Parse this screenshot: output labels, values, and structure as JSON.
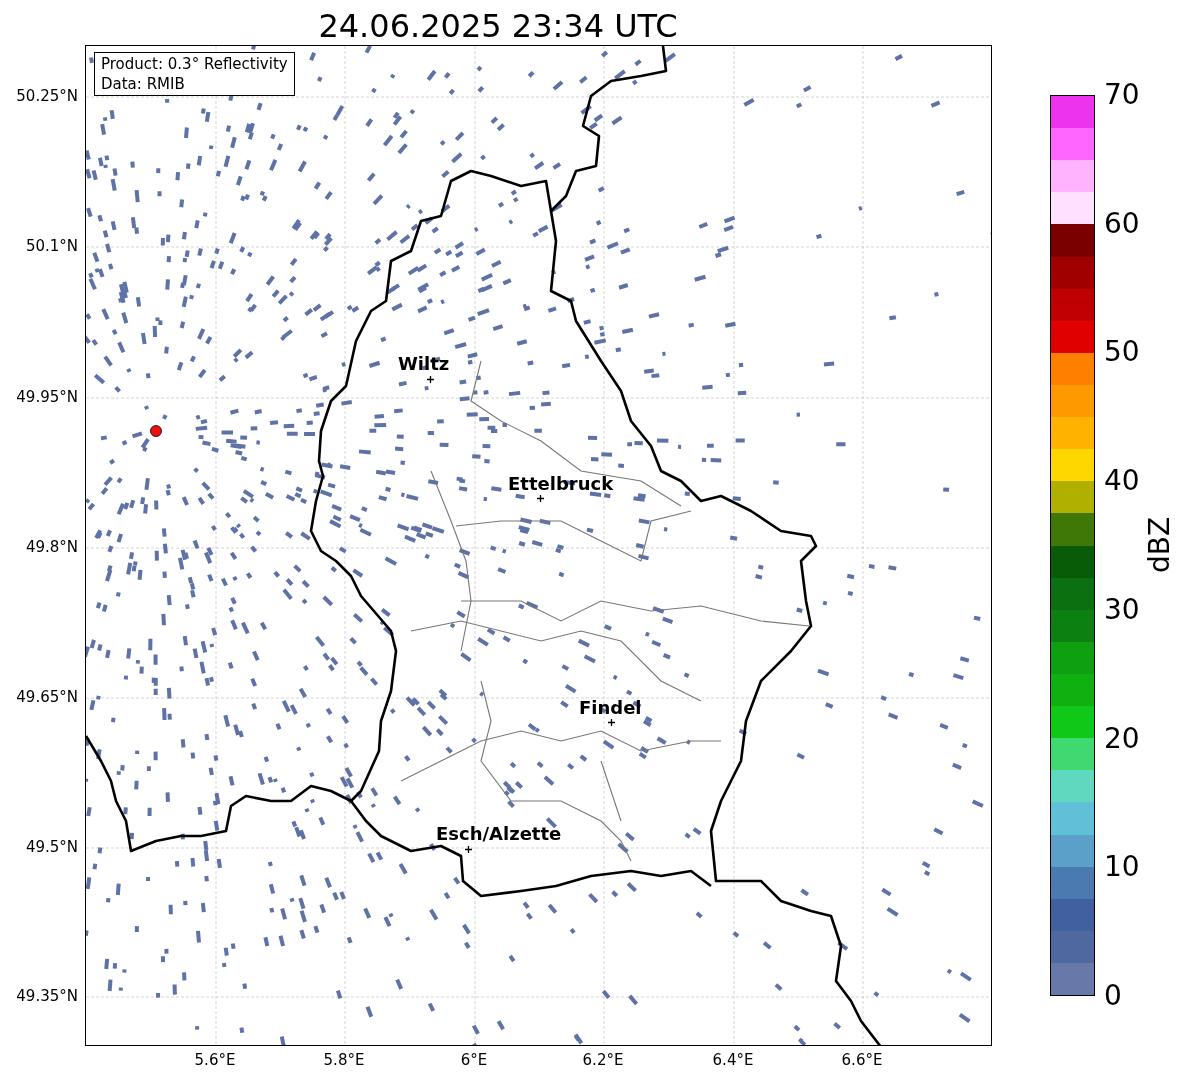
{
  "title": "24.06.2025 23:34 UTC",
  "map": {
    "info_box": [
      "Product: 0.3° Reflectivity",
      "Data: RMIB"
    ],
    "cities": [
      {
        "name": "Wiltz"
      },
      {
        "name": "Ettelbruck"
      },
      {
        "name": "Findel"
      },
      {
        "name": "Esch/Alzette"
      }
    ],
    "lat_ticks": [
      "50.25°N",
      "50.1°N",
      "49.95°N",
      "49.8°N",
      "49.65°N",
      "49.5°N",
      "49.35°N"
    ],
    "lon_ticks": [
      "5.6°E",
      "5.8°E",
      "6°E",
      "6.2°E",
      "6.4°E",
      "6.6°E"
    ]
  },
  "colorbar": {
    "label": "dBZ",
    "ticks": [
      "70",
      "60",
      "50",
      "40",
      "30",
      "20",
      "10",
      "0"
    ],
    "segments": [
      {
        "color": "#ee33ee"
      },
      {
        "color": "#ff66ff"
      },
      {
        "color": "#ffb3ff"
      },
      {
        "color": "#ffe0ff"
      },
      {
        "color": "#7a0000"
      },
      {
        "color": "#a00000"
      },
      {
        "color": "#c00000"
      },
      {
        "color": "#e00000"
      },
      {
        "color": "#ff8000"
      },
      {
        "color": "#ff9900"
      },
      {
        "color": "#ffb300"
      },
      {
        "color": "#ffd700"
      },
      {
        "color": "#b0b000"
      },
      {
        "color": "#407808"
      },
      {
        "color": "#085c08"
      },
      {
        "color": "#0a7010"
      },
      {
        "color": "#0c8010"
      },
      {
        "color": "#0ea010"
      },
      {
        "color": "#10b010"
      },
      {
        "color": "#10c818"
      },
      {
        "color": "#40d870"
      },
      {
        "color": "#60d8c0"
      },
      {
        "color": "#60c0d8"
      },
      {
        "color": "#5aa0c8"
      },
      {
        "color": "#4a7ab0"
      },
      {
        "color": "#4060a0"
      },
      {
        "color": "#5068a0"
      },
      {
        "color": "#6878a8"
      }
    ]
  }
}
